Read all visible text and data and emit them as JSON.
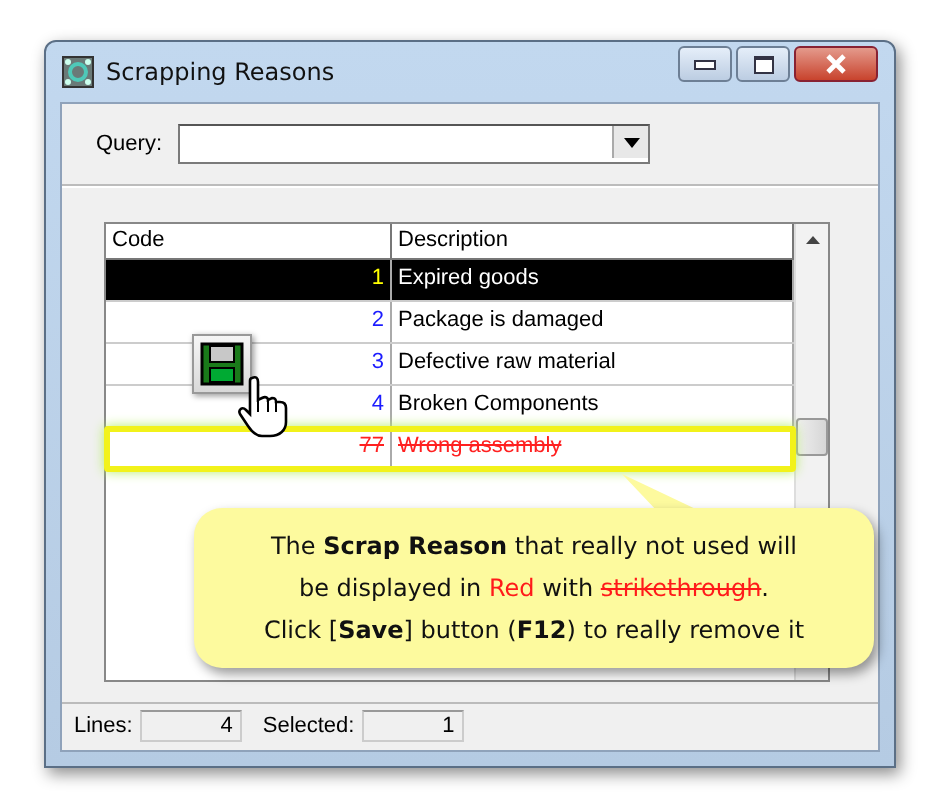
{
  "window": {
    "title": "Scrapping Reasons"
  },
  "query": {
    "label": "Query:"
  },
  "table": {
    "columns": [
      "Code",
      "Description"
    ],
    "rows": [
      {
        "code": "1",
        "description": "Expired goods",
        "selected": true,
        "deleted": false
      },
      {
        "code": "2",
        "description": "Package is damaged",
        "selected": false,
        "deleted": false
      },
      {
        "code": "3",
        "description": "Defective raw material",
        "selected": false,
        "deleted": false
      },
      {
        "code": "4",
        "description": "Broken Components",
        "selected": false,
        "deleted": false
      },
      {
        "code": "77",
        "description": "Wrong assembly",
        "selected": false,
        "deleted": true
      }
    ]
  },
  "callout": {
    "lines": [
      [
        {
          "kind": "plain",
          "text": "The "
        },
        {
          "kind": "bold",
          "text": "Scrap Reason"
        },
        {
          "kind": "plain",
          "text": " that really not used will"
        }
      ],
      [
        {
          "kind": "plain",
          "text": "be displayed in "
        },
        {
          "kind": "red",
          "text": "Red"
        },
        {
          "kind": "plain",
          "text": " with "
        },
        {
          "kind": "strike",
          "text": "strikethrough"
        },
        {
          "kind": "plain",
          "text": "."
        }
      ],
      [
        {
          "kind": "plain",
          "text": "Click ["
        },
        {
          "kind": "bold",
          "text": "Save"
        },
        {
          "kind": "plain",
          "text": "] button ("
        },
        {
          "kind": "bold",
          "text": "F12"
        },
        {
          "kind": "plain",
          "text": ") to really remove it"
        }
      ]
    ]
  },
  "status_bar": {
    "lines_label": "Lines:",
    "lines": "4",
    "selected_label": "Selected:",
    "selected": "1"
  }
}
